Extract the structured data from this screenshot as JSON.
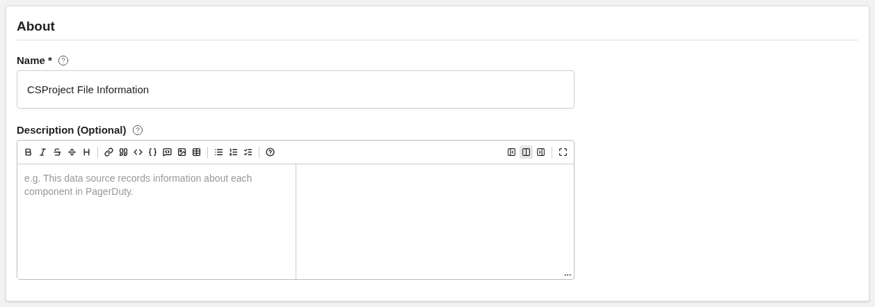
{
  "section": {
    "title": "About"
  },
  "name_field": {
    "label": "Name *",
    "value": "CSProject File Information"
  },
  "description_field": {
    "label": "Description (Optional)",
    "placeholder": "e.g. This data source records information about each component in PagerDuty.",
    "view_modes": [
      {
        "selected": false
      },
      {
        "selected": true
      },
      {
        "selected": false
      }
    ]
  }
}
